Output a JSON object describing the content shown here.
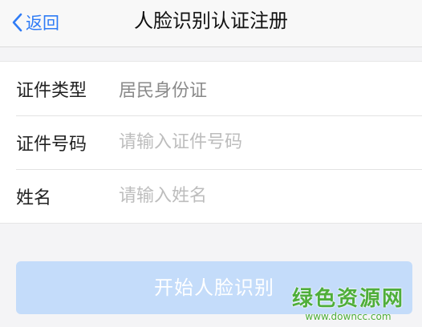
{
  "nav": {
    "back_label": "返回",
    "title": "人脸识别认证注册"
  },
  "form": {
    "rows": [
      {
        "label": "证件类型",
        "value": "居民身份证"
      },
      {
        "label": "证件号码",
        "placeholder": "请输入证件号码"
      },
      {
        "label": "姓名",
        "placeholder": "请输入姓名"
      }
    ]
  },
  "actions": {
    "start_label": "开始人脸识别"
  },
  "watermark": {
    "text_cn": "绿色资源网",
    "text_en": "www.downcc.com"
  },
  "colors": {
    "accent": "#2f7cf6",
    "button_disabled": "#c4dcfa",
    "watermark": "#4fae3a"
  },
  "icons": {
    "back": "chevron-left-icon"
  }
}
